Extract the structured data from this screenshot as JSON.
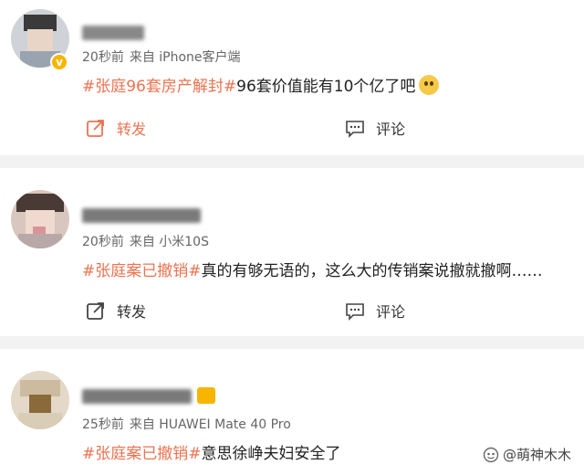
{
  "posts": [
    {
      "time": "20秒前",
      "source": "来自 iPhone客户端",
      "tag": "#张庭96套房产解封#",
      "text": "96套价值能有10个亿了吧",
      "repost_label": "转发",
      "comment_label": "评论",
      "verified_badge": "v"
    },
    {
      "time": "20秒前",
      "source": "来自 小米10S",
      "tag": "#张庭案已撤销#",
      "text": "真的有够无语的，这么大的传销案说撤就撤啊……",
      "repost_label": "转发",
      "comment_label": "评论"
    },
    {
      "time": "25秒前",
      "source": "来自 HUAWEI Mate 40 Pro",
      "tag": "#张庭案已撤销#",
      "text": "意思徐峥夫妇安全了"
    }
  ],
  "watermark": "@萌神木木",
  "colors": {
    "accent": "#eb7350",
    "badge": "#f7b500",
    "divider": "#f2f2f2"
  }
}
